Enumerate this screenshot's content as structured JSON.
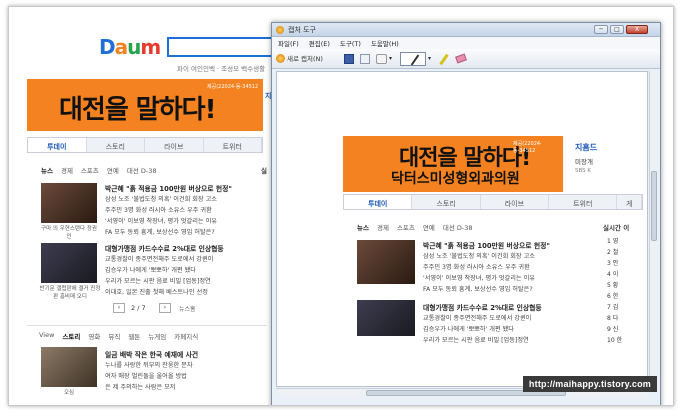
{
  "portal": {
    "sublinks": "파이 여인인벡 · 조성모 백수생활",
    "banner_big": "대전을 말하다!",
    "banner_small": "제공(22024-동-34512",
    "tabs": [
      "투데이",
      "스토리",
      "라이브",
      "트위터"
    ],
    "news_nav": [
      "뉴스",
      "경제",
      "스포츠",
      "연예",
      "대선 D-38"
    ],
    "headline1": "박근혜 \"흙 적용금 100만원 버상으로 헌정\"",
    "lines1": [
      "삼성 노조 '불법도청 의혹' 이건희 회장 고소",
      "주주민 3명 화성 러시아 소유스 우주 귀환",
      "'서영이' 이보영 착장녀, 평가 엇갈리는 이유",
      "FA 모두 동뢰 흥계, 보상선수 영입 허탈은?"
    ],
    "headline2": "대형가맹점 카드수수료 2%대로 인상협둥",
    "lines2": [
      "교통경찰이 종주면전해주 도로에서 강퀸이",
      "김승우가 나에게 '뽀뽀하' 개편 됐다",
      "우리가 모르는 시판 음료 비밀 [업동]정연",
      "이대호, 일본 진출 첫해 베스트나인 선정"
    ],
    "cap1": "구마 의 우현스탠다 정권인",
    "cap2": "반기문 갤럽판에 결거 진정판 흥비매 오디",
    "pager": "2 / 7",
    "news_more": "뉴스홈",
    "story_nav": [
      "View",
      "스토리",
      "영화",
      "뮤직",
      "웹툰",
      "뉴게임",
      "카페지식"
    ],
    "story_headline": "일금 배박 작은 한국 예재에 사건",
    "story_lines": [
      "누나를 사랑한 뒤부의 잔웅한 문자",
      "여자 매장 벌린돌을 울어올 방법",
      "은 제 주의하는 사람은 모저"
    ],
    "story_cap": "오심",
    "right_side": [
      "실",
      "지"
    ],
    "right_labels": [
      "사",
      "미"
    ]
  },
  "window": {
    "title": "캡처 도구",
    "menu": [
      "파일(F)",
      "편집(E)",
      "도구(T)",
      "도움말(H)"
    ],
    "new_capture": "새로 캡처(N)",
    "controls": [
      "─",
      "□",
      "X"
    ]
  },
  "capture": {
    "banner_big": "대전을 말하다!",
    "banner_sub": "닥터스미성형외과의원",
    "banner_small": "제공(22024-동-34512",
    "side_title": "지홈드",
    "side_sub": "미장개",
    "side_sub2": "SBS K",
    "tabs": [
      "투데이",
      "스토리",
      "라이브",
      "트위터",
      "게"
    ],
    "nav": [
      "뉴스",
      "경제",
      "스포츠",
      "연예",
      "대선 D-38"
    ],
    "headline1": "박근혜 \"흙 적용금 100만원 버상으로 헌정\"",
    "lines1": [
      "삼성 노조 '불법도청 의혹' 이건희 회장 고소",
      "주주민 3명 화성 러시아 소유스 우주 귀환",
      "'서영이' 이보영 착장녀, 평가 엇갈리는 이유",
      "FA 모두 동뢰 흥계, 보상선수 영입 허탈은?"
    ],
    "headline2": "대형가맹점 카드수수료 2%대로 인상협둥",
    "lines2": [
      "교통경찰이 종주면전해주 도로에서 강퀸이",
      "김승우가 나에게 '뽀뽀하' 개편 됐다",
      "우리가 모르는 시판 음료 비밀 [업동]정연"
    ],
    "rank_title": "실시간 이",
    "rank_items": [
      "1 영",
      "2 철",
      "3 안",
      "4 이",
      "5 황",
      "6 한",
      "7 김",
      "8 다",
      "9 신",
      "10 한"
    ]
  },
  "watermark": "http://maihappy.tistory.com",
  "colors": {
    "accent": "#1a56b4",
    "banner": "#f58220"
  }
}
